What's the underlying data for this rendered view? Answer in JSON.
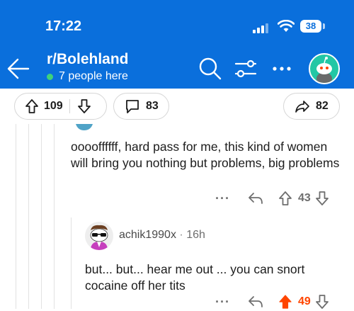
{
  "status_bar": {
    "time": "17:22",
    "battery": "38"
  },
  "header": {
    "subreddit": "r/Bolehland",
    "presence": "7 people here"
  },
  "post_actions": {
    "upvotes": "109",
    "comments": "83",
    "shares": "82"
  },
  "comment1": {
    "text": "ooooffffff, hard pass for me, this kind of women will bring you nothing but problems, big problems",
    "votes": "43",
    "more": "···"
  },
  "comment2": {
    "author": "achik1990x",
    "age": "16h",
    "text": "but... but... hear me out ... you can snort cocaine off her tits",
    "votes": "49",
    "more": "···"
  },
  "colors": {
    "header": "#0a6fdc",
    "upvoted": "#ff4500",
    "online": "#3fd27a",
    "avatar_bg": "#22c7a5"
  }
}
